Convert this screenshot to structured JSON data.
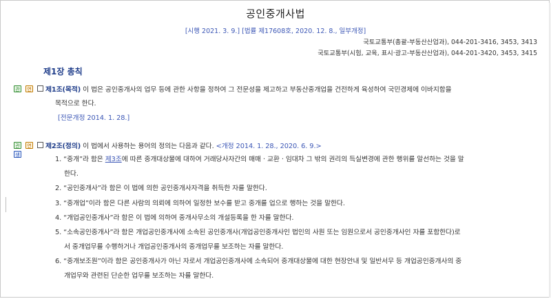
{
  "document": {
    "title": "공인중개사법",
    "enactment": "[시행 2021. 3. 9.] [법률 제17608호, 2020. 12. 8., 일부개정]",
    "ministry_1": "국토교통부(총괄-부동산산업과), 044-201-3416, 3453, 3413",
    "ministry_2": "국토교통부(시험, 교육, 표시·광고-부동산산업과), 044-201-3420, 3453, 3415"
  },
  "chapter": "제1장 총칙",
  "badges": {
    "related": "관",
    "history": "연",
    "life": "생"
  },
  "article1": {
    "title": "제1조(목적)",
    "text_line1": "이 법은 공인중개사의 업무 등에 관한 사항을 정하여 그 전문성을 제고하고 부동산중개업을 건전하게 육성하여 국민경제에 이바지함을",
    "text_line2": "목적으로 한다.",
    "amendment": "[전문개정 2014. 1. 28.]"
  },
  "article2": {
    "title": "제2조(정의)",
    "text": "이 법에서 사용하는 용어의 정의는 다음과 같다.",
    "amendment": "<개정 2014. 1. 28., 2020. 6. 9.>",
    "item1_pre": "1. “중개”라 함은 ",
    "item1_link": "제3조",
    "item1_post": "에 따른 중개대상물에 대하여 거래당사자간의 매매 · 교환 · 임대차 그 밖의 권리의 득실변경에 관한 행위를 알선하는 것을 말",
    "item1_line2": "한다.",
    "item2": "2. “공인중개사”라 함은 이 법에 의한 공인중개사자격을 취득한 자를 말한다.",
    "item3": "3. “중개업”이라 함은 다른 사람의 의뢰에 의하여 일정한 보수를 받고 중개를 업으로 행하는 것을 말한다.",
    "item4": "4. “개업공인중개사”라 함은 이 법에 의하여 중개사무소의 개설등록을 한 자를 말한다.",
    "item5_line1": "5. “소속공인중개사”라 함은 개업공인중개사에 소속된 공인중개사(개업공인중개사인 법인의 사원 또는 임원으로서 공인중개사인 자를 포함한다)로",
    "item5_line2": "서 중개업무를 수행하거나 개업공인중개사의 중개업무를 보조하는 자를 말한다.",
    "item6_line1": "6. “중개보조원”이라 함은 공인중개사가 아닌 자로서 개업공인중개사에 소속되어 중개대상물에 대한 현장안내 및 일반서무 등 개업공인중개사의 중",
    "item6_line2": "개업무와 관련된 단순한 업무를 보조하는 자를 말한다."
  }
}
